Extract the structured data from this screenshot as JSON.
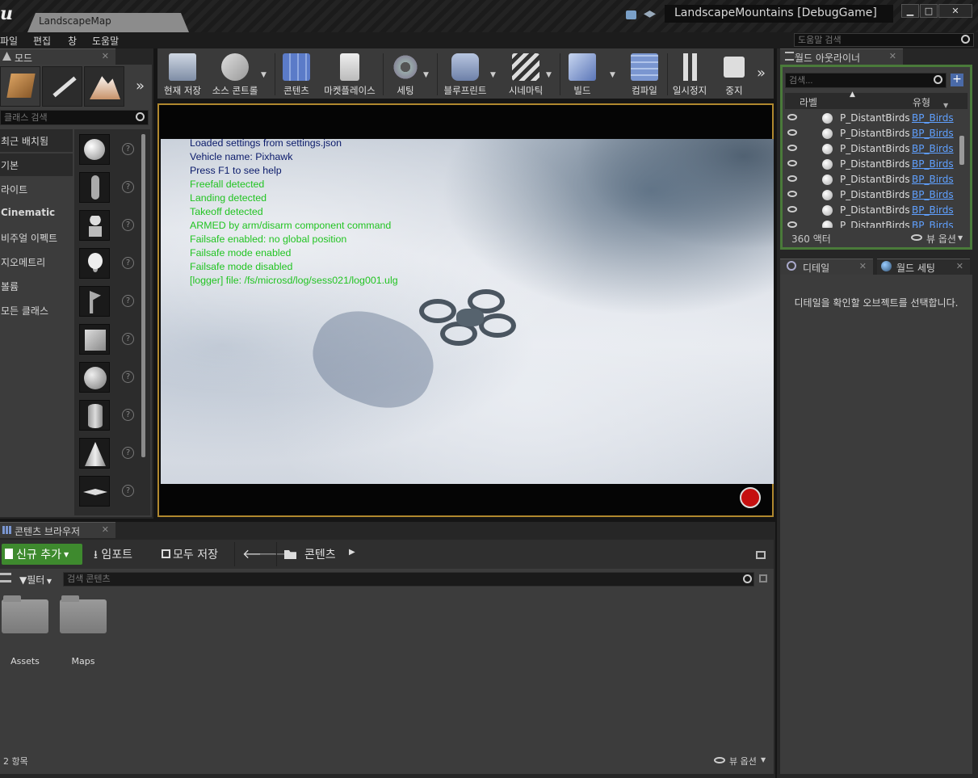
{
  "window": {
    "map_tab": "LandscapeMap",
    "project_title": "LandscapeMountains [DebugGame]"
  },
  "menu": [
    "파일",
    "편집",
    "창",
    "도움말"
  ],
  "help_search_placeholder": "도움말 검색",
  "modes": {
    "tab_title": "모드",
    "class_search_placeholder": "클래스 검색",
    "categories": [
      "최근 배치됨",
      "기본",
      "라이트",
      "Cinematic",
      "비주얼 이펙트",
      "지오메트리",
      "볼륨",
      "모든 클래스"
    ]
  },
  "toolbar": {
    "buttons": [
      {
        "label": "현재 저장",
        "icon": "save-icon"
      },
      {
        "label": "소스 콘트롤",
        "icon": "source-control-icon"
      },
      {
        "label": "콘텐츠",
        "icon": "content-icon"
      },
      {
        "label": "마켓플레이스",
        "icon": "marketplace-icon"
      },
      {
        "label": "세팅",
        "icon": "settings-icon"
      },
      {
        "label": "블루프린트",
        "icon": "blueprint-icon"
      },
      {
        "label": "시네마틱",
        "icon": "cinematic-icon"
      },
      {
        "label": "빌드",
        "icon": "build-icon"
      },
      {
        "label": "컴파일",
        "icon": "compile-icon"
      },
      {
        "label": "일시정지",
        "icon": "pause-icon"
      },
      {
        "label": "중지",
        "icon": "stop-icon"
      }
    ]
  },
  "viewport": {
    "log_lines": [
      {
        "text": "Loaded settings from settings.json",
        "color": "#0a1a6a"
      },
      {
        "text": "Vehicle name: Pixhawk",
        "color": "#0a1a6a"
      },
      {
        "text": "Press F1 to see help",
        "color": "#0a1a6a"
      },
      {
        "text": "Freefall detected",
        "color": "#22c422"
      },
      {
        "text": "Landing detected",
        "color": "#22c422"
      },
      {
        "text": "Takeoff detected",
        "color": "#22c422"
      },
      {
        "text": "ARMED by arm/disarm component command",
        "color": "#22c422"
      },
      {
        "text": "Failsafe enabled: no global position",
        "color": "#22c422"
      },
      {
        "text": "Failsafe mode enabled",
        "color": "#22c422"
      },
      {
        "text": "Failsafe mode disabled",
        "color": "#22c422"
      },
      {
        "text": "[logger] file: /fs/microsd/log/sess021/log001.ulg",
        "color": "#22c422"
      }
    ]
  },
  "outliner": {
    "tab_title": "월드 아웃라이너",
    "search_placeholder": "검색...",
    "col_label": "라벨",
    "col_type": "유형",
    "rows": [
      {
        "name": "P_DistantBirds_I",
        "type": "BP_Birds"
      },
      {
        "name": "P_DistantBirds_I",
        "type": "BP_Birds"
      },
      {
        "name": "P_DistantBirds_I",
        "type": "BP_Birds"
      },
      {
        "name": "P_DistantBirds_I",
        "type": "BP_Birds"
      },
      {
        "name": "P_DistantBirds_I",
        "type": "BP_Birds"
      },
      {
        "name": "P_DistantBirds_I",
        "type": "BP_Birds"
      },
      {
        "name": "P_DistantBirds_I",
        "type": "BP_Birds"
      },
      {
        "name": "P_DistantBirds_I",
        "type": "BP_Birds"
      }
    ],
    "actor_count": "360 액터",
    "view_options": "뷰 옵션"
  },
  "details": {
    "tab_details": "디테일",
    "tab_world_settings": "월드 세팅",
    "empty_message": "디테일을 확인할 오브젝트를 선택합니다."
  },
  "content_browser": {
    "tab_title": "콘텐츠 브라우저",
    "add_new": "신규 추가",
    "import": "임포트",
    "save_all": "모두 저장",
    "path": "콘텐츠",
    "filter": "필터",
    "search_placeholder": "검색 콘텐츠",
    "folders": [
      "Assets",
      "Maps"
    ],
    "item_count": "2 항목",
    "view_options": "뷰 옵션"
  }
}
